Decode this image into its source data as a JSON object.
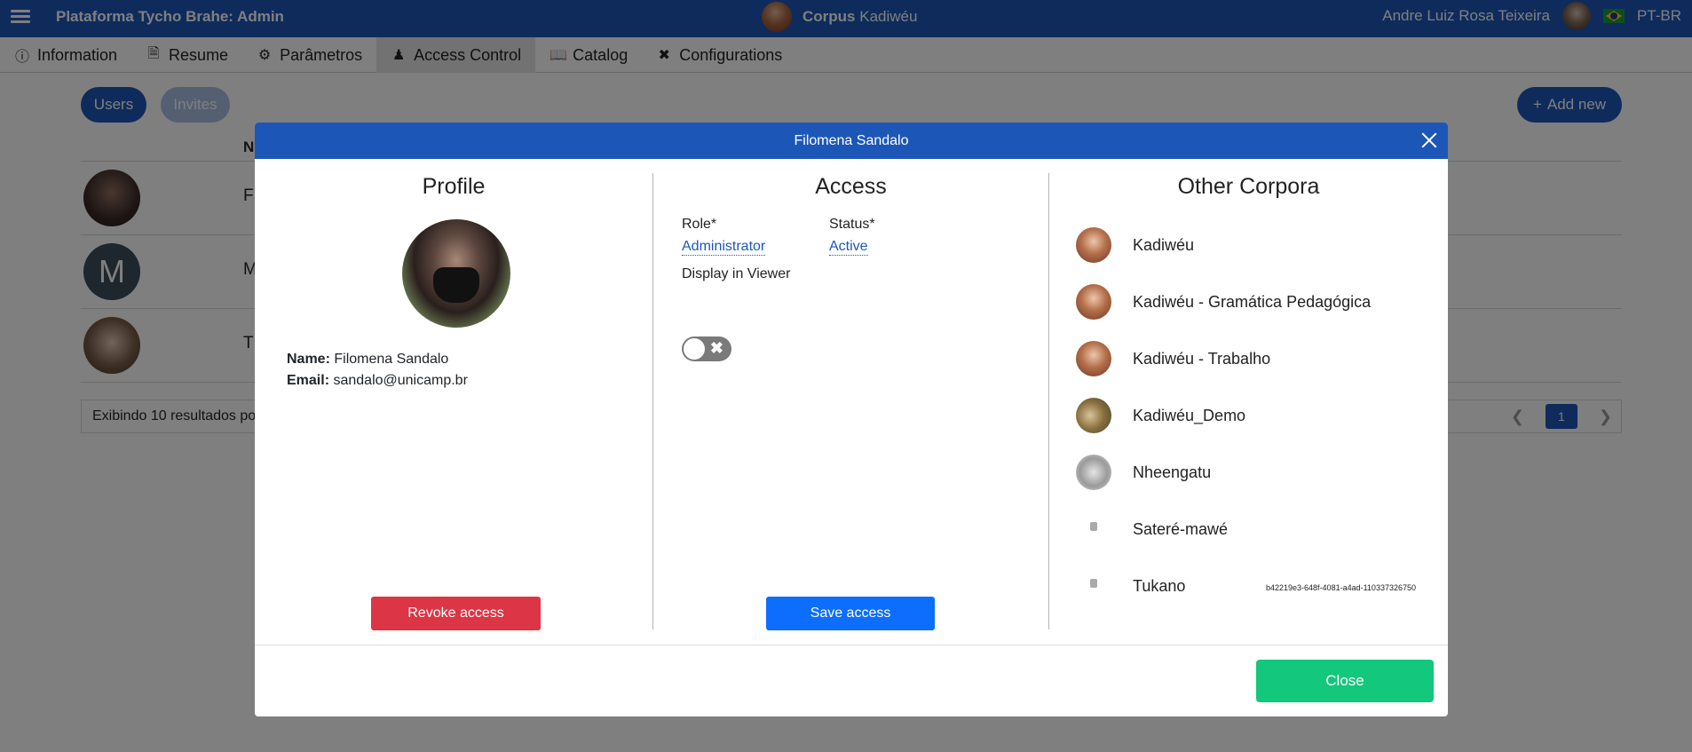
{
  "topbar": {
    "app_title": "Plataforma Tycho Brahe: Admin",
    "corpus_label": "Corpus",
    "corpus_name": "Kadiwéu",
    "user_name": "Andre Luiz Rosa Teixeira",
    "language": "PT-BR"
  },
  "nav": {
    "tabs": [
      {
        "label": "Information",
        "icon": "info-icon"
      },
      {
        "label": "Resume",
        "icon": "document-icon"
      },
      {
        "label": "Parâmetros",
        "icon": "gears-icon"
      },
      {
        "label": "Access Control",
        "icon": "users-icon"
      },
      {
        "label": "Catalog",
        "icon": "book-icon"
      },
      {
        "label": "Configurations",
        "icon": "tools-icon"
      }
    ],
    "active": "Access Control"
  },
  "background": {
    "users_label": "Users",
    "invites_label": "Invites",
    "add_new_label": "Add new",
    "column_header": "N",
    "rows": [
      {
        "letter": "F"
      },
      {
        "letter": "M",
        "avatar_letter": "M"
      },
      {
        "letter": "T"
      }
    ],
    "footer_text": "Exibindo 10 resultados po",
    "current_page": "1"
  },
  "modal": {
    "title": "Filomena Sandalo",
    "profile": {
      "heading": "Profile",
      "name_label": "Name:",
      "name_value": "Filomena Sandalo",
      "email_label": "Email:",
      "email_value": "sandalo@unicamp.br",
      "revoke_label": "Revoke access"
    },
    "access": {
      "heading": "Access",
      "role_label": "Role*",
      "role_value": "Administrator",
      "status_label": "Status*",
      "status_value": "Active",
      "display_label": "Display in Viewer",
      "display_enabled": false,
      "save_label": "Save access"
    },
    "other": {
      "heading": "Other Corpora",
      "items": [
        {
          "name": "Kadiwéu"
        },
        {
          "name": "Kadiwéu - Gramática Pedagógica"
        },
        {
          "name": "Kadiwéu - Trabalho"
        },
        {
          "name": "Kadiwéu_Demo"
        },
        {
          "name": "Nheengatu"
        },
        {
          "name": "Sateré-mawé"
        },
        {
          "name": "Tukano"
        }
      ],
      "uuid": "b42219e3-648f-4081-a4ad-110337326750"
    },
    "close_label": "Close"
  },
  "colors": {
    "primary": "#1c57b8",
    "danger": "#dc3545",
    "save": "#0d6efd",
    "success": "#13c77c"
  }
}
